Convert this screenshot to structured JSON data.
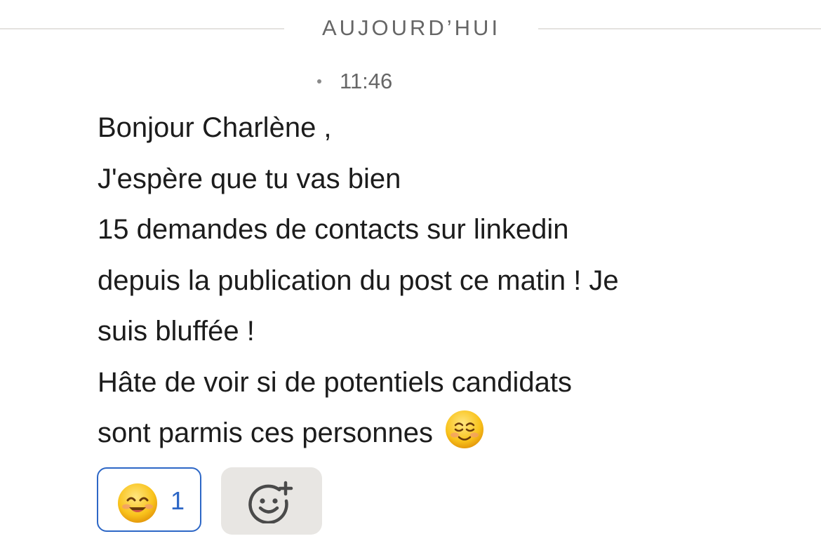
{
  "divider": {
    "label": "AUJOURD’HUI"
  },
  "message": {
    "time": "11:46",
    "lines": [
      "Bonjour Charlène ,",
      "J'espère que tu vas bien",
      "15 demandes de contacts sur linkedin",
      "depuis la publication du post ce matin ! Je",
      "suis bluffée  !",
      "Hâte de voir si de potentiels candidats",
      "sont parmis ces personnes"
    ],
    "trailing_emoji": "smiling-face-with-closed-eyes"
  },
  "reactions": [
    {
      "emoji": "smiling-face-with-smiling-eyes",
      "count": "1"
    }
  ],
  "add_reaction_icon": "add-reaction-icon",
  "colors": {
    "accent": "#2d67c6",
    "divider_text": "#666666",
    "add_reaction_bg": "#e8e6e3"
  }
}
